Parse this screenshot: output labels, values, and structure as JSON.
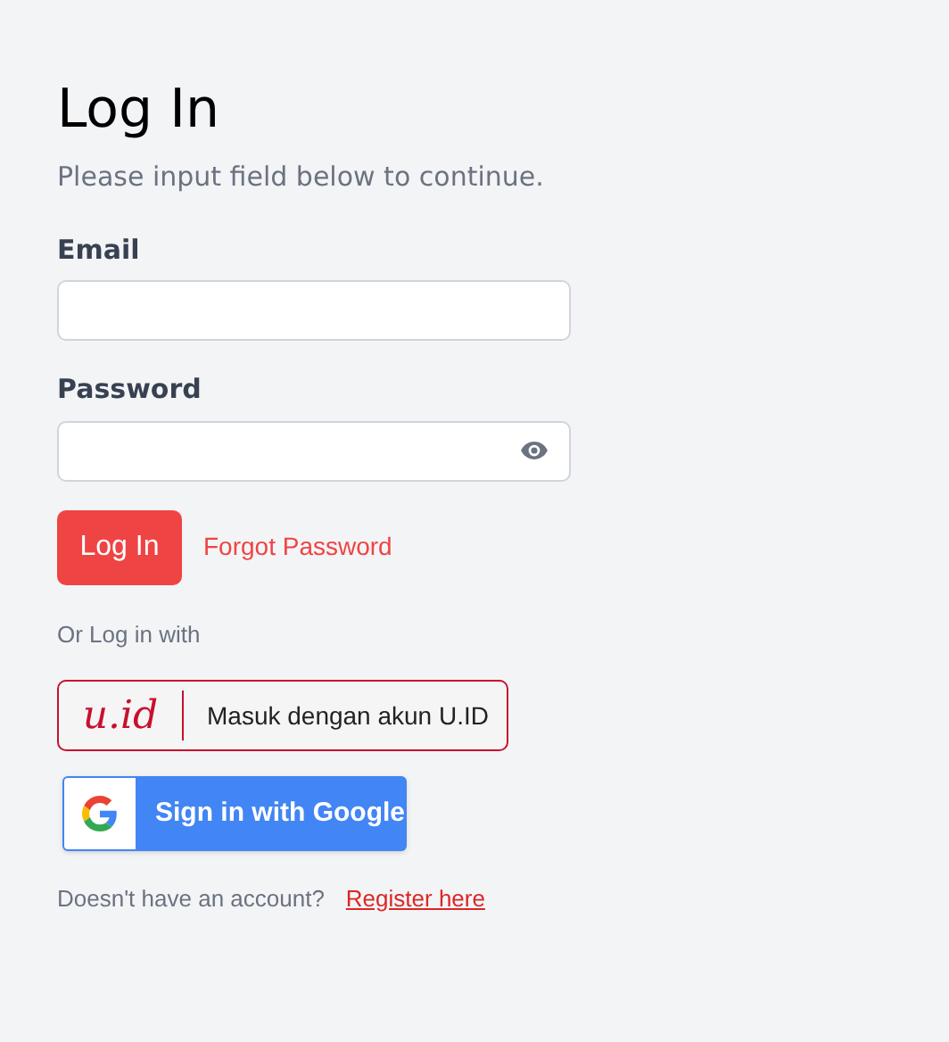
{
  "title": "Log In",
  "subtitle": "Please input field below to continue.",
  "fields": [
    {
      "label": "Email",
      "kind": "text"
    },
    {
      "label": "Password",
      "kind": "password"
    }
  ],
  "login_button": "Log In",
  "forgot_link": "Forgot Password",
  "alt_label": "Or Log in with",
  "uid_button": {
    "logo": "u.id",
    "label": "Masuk dengan akun U.ID"
  },
  "google_button": {
    "label": "Sign in with Google"
  },
  "footer": {
    "text": "Doesn't have an account?",
    "link": "Register here"
  }
}
